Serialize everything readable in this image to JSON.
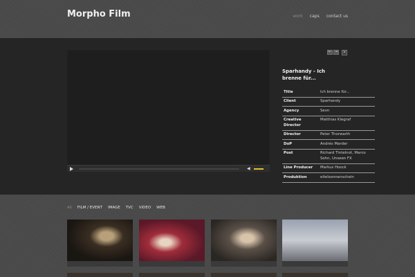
{
  "header": {
    "logo": "Morpho Film",
    "nav": [
      "work",
      "caps",
      "contact us"
    ]
  },
  "player": {
    "pager_prev": "←",
    "pager_next": "→",
    "close": "×"
  },
  "info": {
    "title": "Sparhandy - Ich brenne für...",
    "rows": [
      {
        "key": "Title",
        "value": "Ich brenne für..."
      },
      {
        "key": "Client",
        "value": "Sparhandy"
      },
      {
        "key": "Agency",
        "value": "Sevn"
      },
      {
        "key": "Creative Director",
        "value": "Matthias Klegraf"
      },
      {
        "key": "Director",
        "value": "Peter Thorwarth"
      },
      {
        "key": "DoP",
        "value": "Andrés Marder"
      },
      {
        "key": "Post",
        "value": "Richard Tintelnot, Marco Sohn, Unseen FX"
      },
      {
        "key": "Line Producer",
        "value": "Markus Hoock"
      },
      {
        "key": "Produktion",
        "value": "eitelsonnenschein"
      }
    ]
  },
  "filters": [
    "All",
    "FILM / EVENT",
    "IMAGE",
    "TVC",
    "VIDEO",
    "WEB"
  ],
  "colors": {
    "accent": "#e6c22c",
    "stage": "#252525"
  }
}
